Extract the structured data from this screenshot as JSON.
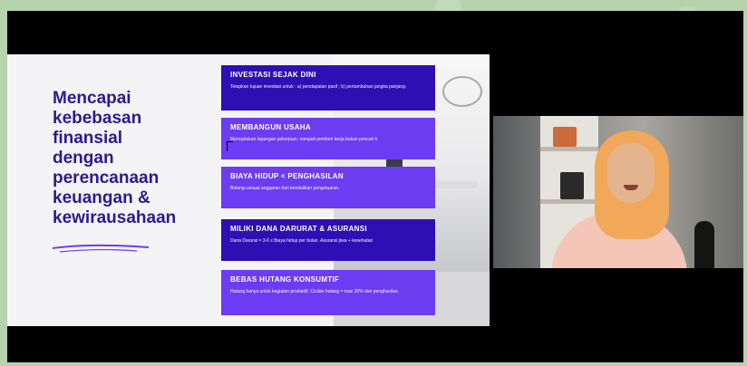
{
  "slide": {
    "heading": "Mencapai\nkebebasan\nfinansial\ndengan\nperencanaan\nkeuangan &\nkewirausahaan",
    "cards": [
      {
        "title": "INVESTASI  SEJAK DINI",
        "text": "Tetapkan tujuan investasi untuk : a) pendapatan pasif ; b) pertumbuhan jangka panjang."
      },
      {
        "title": "MEMBANGUN USAHA",
        "text": "Menciptakan lapangan pekerjaan, menjadi pemberi kerja bukan pencari k"
      },
      {
        "title": "BIAYA HIDUP < PENGHASILAN",
        "text": "Belanja sesuai anggaran dan kendalikan pengeluaran."
      },
      {
        "title": "MILIKI DANA DARURAT & ASURANSI",
        "text": "Dana Darurat = 3-6 x Biaya hidup per bulan. Asuransi jiwa + kesehatan"
      },
      {
        "title": "BEBAS HUTANG KONSUMTIF",
        "text": "Hutang hanya untuk kegiatan produktif. Cicilan hutang = max 30% dari penghasilan."
      }
    ]
  },
  "colors": {
    "heading": "#2d1a8e",
    "card_dark": "#2e0fb3",
    "card_light": "#6b3cf2",
    "background": "#b7d3ae"
  }
}
